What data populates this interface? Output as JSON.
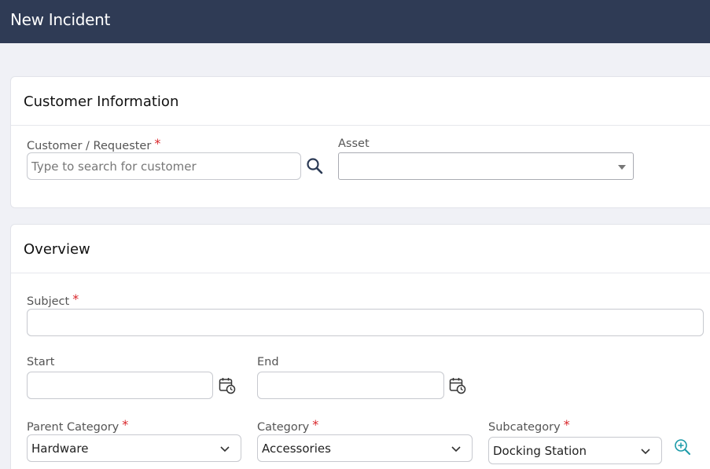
{
  "header": {
    "title": "New Incident"
  },
  "customer_section": {
    "title": "Customer Information",
    "customer_label": "Customer / Requester",
    "customer_required": "*",
    "customer_placeholder": "Type to search for customer",
    "customer_value": "",
    "asset_label": "Asset",
    "asset_value": ""
  },
  "overview_section": {
    "title": "Overview",
    "subject_label": "Subject",
    "subject_required": "*",
    "subject_value": "",
    "start_label": "Start",
    "start_value": "",
    "end_label": "End",
    "end_value": "",
    "parent_category_label": "Parent Category",
    "parent_category_required": "*",
    "parent_category_value": "Hardware",
    "category_label": "Category",
    "category_required": "*",
    "category_value": "Accessories",
    "subcategory_label": "Subcategory",
    "subcategory_required": "*",
    "subcategory_value": "Docking Station"
  },
  "icons": {
    "search": "search-icon",
    "calendar": "calendar-clock-icon",
    "dropdown": "caret-down-icon",
    "chevron": "chevron-down-icon",
    "zoom": "zoom-in-icon"
  },
  "colors": {
    "header_bg": "#2f3b55",
    "required": "#d9262a",
    "zoom_icon": "#1a9aa8"
  }
}
